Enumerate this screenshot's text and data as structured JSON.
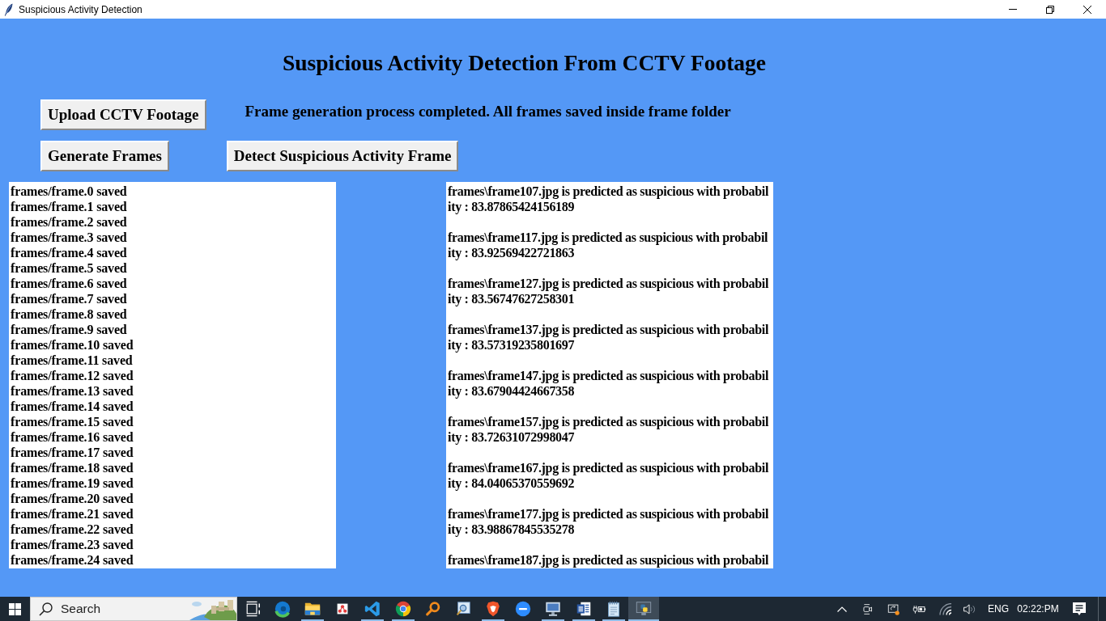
{
  "window": {
    "title": "Suspicious Activity Detection"
  },
  "heading": "Suspicious Activity Detection From CCTV Footage",
  "buttons": [
    {
      "label": "Upload CCTV Footage"
    },
    {
      "label": "Generate Frames"
    },
    {
      "label": "Detect Suspicious Activity Frame"
    }
  ],
  "status_message": "Frame generation process completed. All frames saved inside frame folder",
  "frames_log": [
    "frames/frame.0 saved",
    "frames/frame.1 saved",
    "frames/frame.2 saved",
    "frames/frame.3 saved",
    "frames/frame.4 saved",
    "frames/frame.5 saved",
    "frames/frame.6 saved",
    "frames/frame.7 saved",
    "frames/frame.8 saved",
    "frames/frame.9 saved",
    "frames/frame.10 saved",
    "frames/frame.11 saved",
    "frames/frame.12 saved",
    "frames/frame.13 saved",
    "frames/frame.14 saved",
    "frames/frame.15 saved",
    "frames/frame.16 saved",
    "frames/frame.17 saved",
    "frames/frame.18 saved",
    "frames/frame.19 saved",
    "frames/frame.20 saved",
    "frames/frame.21 saved",
    "frames/frame.22 saved",
    "frames/frame.23 saved",
    "frames/frame.24 saved"
  ],
  "predictions_log": [
    {
      "lines": [
        "frames\\frame107.jpg is predicted as suspicious with probabil",
        "ity : 83.87865424156189"
      ]
    },
    {
      "lines": [
        "frames\\frame117.jpg is predicted as suspicious with probabil",
        "ity : 83.92569422721863"
      ]
    },
    {
      "lines": [
        "frames\\frame127.jpg is predicted as suspicious with probabil",
        "ity : 83.56747627258301"
      ]
    },
    {
      "lines": [
        "frames\\frame137.jpg is predicted as suspicious with probabil",
        "ity : 83.57319235801697"
      ]
    },
    {
      "lines": [
        "frames\\frame147.jpg is predicted as suspicious with probabil",
        "ity : 83.67904424667358"
      ]
    },
    {
      "lines": [
        "frames\\frame157.jpg is predicted as suspicious with probabil",
        "ity : 83.72631072998047"
      ]
    },
    {
      "lines": [
        "frames\\frame167.jpg is predicted as suspicious with probabil",
        "ity : 84.04065370559692"
      ]
    },
    {
      "lines": [
        "frames\\frame177.jpg is predicted as suspicious with probabil",
        "ity : 83.98867845535278"
      ]
    },
    {
      "lines": [
        "frames\\frame187.jpg is predicted as suspicious with probabil"
      ]
    }
  ],
  "taskbar": {
    "search": {
      "placeholder": "Search"
    },
    "apps": [
      {
        "kind": "task-view",
        "running": false,
        "selected": false
      },
      {
        "kind": "swirl",
        "running": false,
        "selected": false
      },
      {
        "kind": "folder",
        "running": true,
        "selected": false
      },
      {
        "kind": "dots-tile",
        "running": false,
        "selected": false
      },
      {
        "kind": "ribbon",
        "running": true,
        "selected": false
      },
      {
        "kind": "tricolor",
        "running": true,
        "selected": false
      },
      {
        "kind": "magnifier",
        "running": false,
        "selected": false
      },
      {
        "kind": "image-viewer",
        "running": false,
        "selected": false
      },
      {
        "kind": "shield",
        "running": true,
        "selected": false
      },
      {
        "kind": "disc",
        "running": false,
        "selected": false
      },
      {
        "kind": "monitor",
        "running": true,
        "selected": false
      },
      {
        "kind": "document",
        "running": true,
        "selected": false
      },
      {
        "kind": "notepad",
        "running": true,
        "selected": false
      },
      {
        "kind": "screen",
        "running": true,
        "selected": true
      }
    ],
    "language": "ENG",
    "time": "02:22:PM"
  }
}
